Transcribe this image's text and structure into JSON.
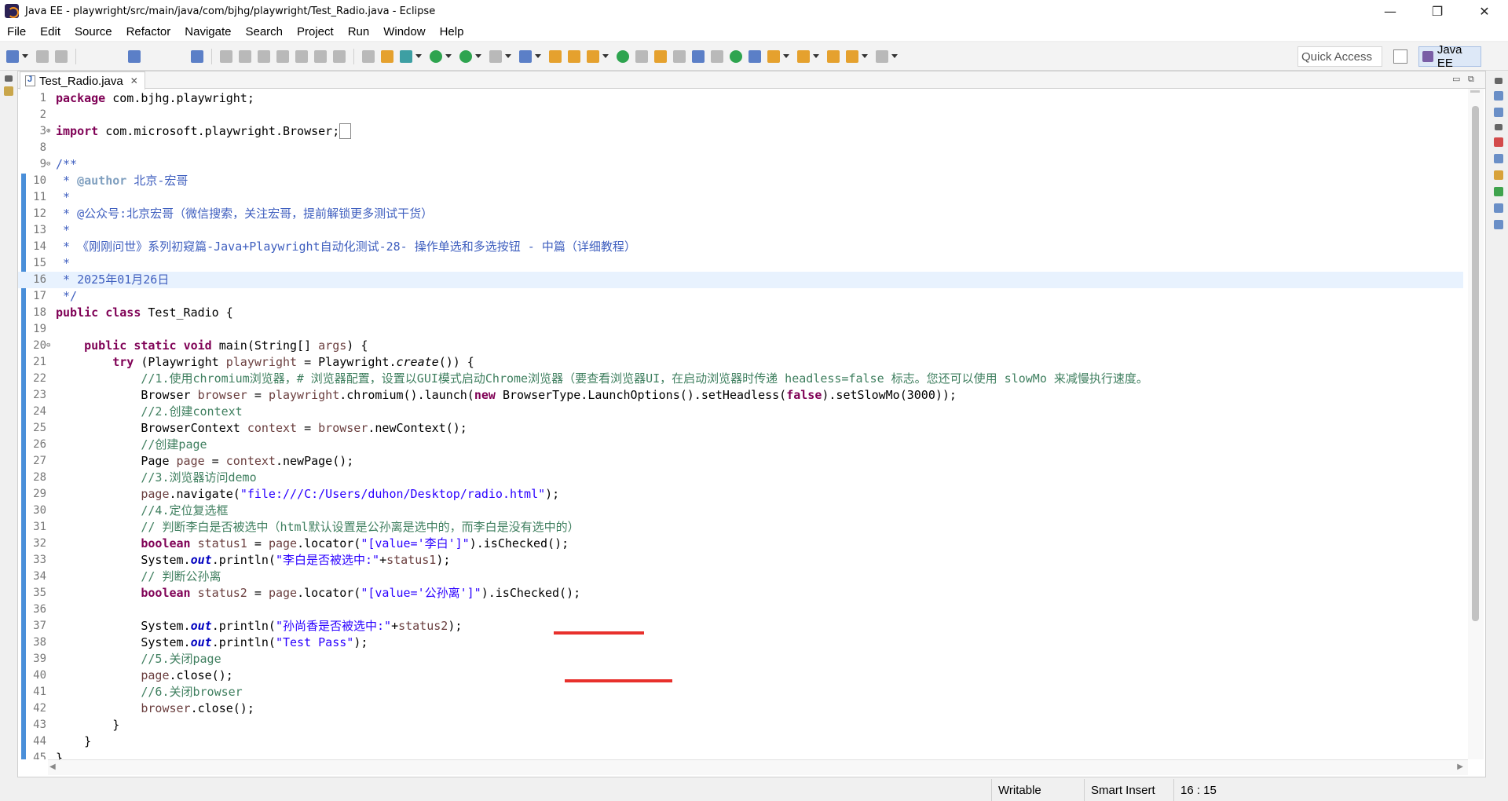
{
  "window": {
    "title": "Java EE - playwright/src/main/java/com/bjhg/playwright/Test_Radio.java - Eclipse",
    "minimize": "—",
    "maximize": "❐",
    "close": "✕"
  },
  "menu": [
    "File",
    "Edit",
    "Source",
    "Refactor",
    "Navigate",
    "Search",
    "Project",
    "Run",
    "Window",
    "Help"
  ],
  "toolbar": {
    "quick_access": "Quick Access",
    "perspective": "Java EE"
  },
  "editor": {
    "tab_label": "Test_Radio.java",
    "tab_close": "✕",
    "current_line": 16,
    "lines": [
      {
        "n": "1",
        "html": "<span class=\"kw\">package</span> com.bjhg.playwright;"
      },
      {
        "n": "2",
        "html": ""
      },
      {
        "n": "3",
        "fold": "⊕",
        "html": "<span class=\"kw\">import</span> com.microsoft.playwright.Browser;<span style=\"border:1px solid #888;padding:0 2px;\"> </span>"
      },
      {
        "n": "8",
        "html": ""
      },
      {
        "n": "9",
        "fold": "⊖",
        "html": "<span class=\"jd\">/**</span>"
      },
      {
        "n": "10",
        "html": "<span class=\"jd\"> * </span><span class=\"tag\">@author</span><span class=\"jd\"> 北京-宏哥</span>"
      },
      {
        "n": "11",
        "html": "<span class=\"jd\"> *</span>"
      },
      {
        "n": "12",
        "html": "<span class=\"jd\"> * @公众号:北京宏哥（微信搜索，关注宏哥，提前解锁更多测试干货）</span>"
      },
      {
        "n": "13",
        "html": "<span class=\"jd\"> *</span>"
      },
      {
        "n": "14",
        "html": "<span class=\"jd\"> * 《刚刚问世》系列初窥篇-Java+Playwright自动化测试-28- 操作单选和多选按钮 - 中篇（详细教程）</span>"
      },
      {
        "n": "15",
        "html": "<span class=\"jd\"> *</span>"
      },
      {
        "n": "16",
        "html": "<span class=\"jd\"> * 2025年01月26日</span>"
      },
      {
        "n": "17",
        "html": "<span class=\"jd\"> */</span>"
      },
      {
        "n": "18",
        "html": "<span class=\"kw\">public</span> <span class=\"kw\">class</span> Test_Radio {"
      },
      {
        "n": "19",
        "html": ""
      },
      {
        "n": "20",
        "fold": "⊖",
        "html": "    <span class=\"kw\">public</span> <span class=\"kw\">static</span> <span class=\"kw\">void</span> main(String[] <span class=\"lv\">args</span>) {"
      },
      {
        "n": "21",
        "html": "        <span class=\"kw\">try</span> (Playwright <span class=\"lv\">playwright</span> = Playwright.<span class=\"it\">create</span>()) {"
      },
      {
        "n": "22",
        "html": "            <span class=\"cm\">//1.使用chromium浏览器，# 浏览器配置，设置以GUI模式启动Chrome浏览器（要查看浏览器UI，在启动浏览器时传递 headless=false 标志。您还可以使用 slowMo 来减慢执行速度。</span>"
      },
      {
        "n": "23",
        "html": "            Browser <span class=\"lv\">browser</span> = <span class=\"lv\">playwright</span>.chromium().launch(<span class=\"kw\">new</span> BrowserType.LaunchOptions().setHeadless(<span class=\"kw\">false</span>).setSlowMo(3000));"
      },
      {
        "n": "24",
        "html": "            <span class=\"cm\">//2.创建context</span>"
      },
      {
        "n": "25",
        "html": "            BrowserContext <span class=\"lv\">context</span> = <span class=\"lv\">browser</span>.newContext();"
      },
      {
        "n": "26",
        "html": "            <span class=\"cm\">//创建page</span>"
      },
      {
        "n": "27",
        "html": "            Page <span class=\"lv\">page</span> = <span class=\"lv\">context</span>.newPage();"
      },
      {
        "n": "28",
        "html": "            <span class=\"cm\">//3.浏览器访问demo</span>"
      },
      {
        "n": "29",
        "html": "            <span class=\"lv\">page</span>.navigate(<span class=\"str\">\"file:///C:/Users/duhon/Desktop/radio.html\"</span>);"
      },
      {
        "n": "30",
        "html": "            <span class=\"cm\">//4.定位复选框</span>"
      },
      {
        "n": "31",
        "html": "            <span class=\"cm\">// 判断李白是否被选中（html默认设置是公孙离是选中的，而李白是没有选中的）</span>"
      },
      {
        "n": "32",
        "html": "            <span class=\"kw\">boolean</span> <span class=\"lv\">status1</span> = <span class=\"lv\">page</span>.locator(<span class=\"str\">\"[value='李白']\"</span>).isChecked();"
      },
      {
        "n": "33",
        "html": "            System.<span class=\"fld\">out</span>.println(<span class=\"str\">\"李白是否被选中:\"</span>+<span class=\"lv\">status1</span>);"
      },
      {
        "n": "34",
        "html": "            <span class=\"cm\">// 判断公孙离</span>"
      },
      {
        "n": "35",
        "html": "            <span class=\"kw\">boolean</span> <span class=\"lv\">status2</span> = <span class=\"lv\">page</span>.locator(<span class=\"str\">\"[value='公孙离']\"</span>).isChecked();"
      },
      {
        "n": "36",
        "html": ""
      },
      {
        "n": "37",
        "html": "            System.<span class=\"fld\">out</span>.println(<span class=\"str\">\"孙尚香是否被选中:\"</span>+<span class=\"lv\">status2</span>);"
      },
      {
        "n": "38",
        "html": "            System.<span class=\"fld\">out</span>.println(<span class=\"str\">\"Test Pass\"</span>);"
      },
      {
        "n": "39",
        "html": "            <span class=\"cm\">//5.关闭page</span>"
      },
      {
        "n": "40",
        "html": "            <span class=\"lv\">page</span>.close();"
      },
      {
        "n": "41",
        "html": "            <span class=\"cm\">//6.关闭browser</span>"
      },
      {
        "n": "42",
        "html": "            <span class=\"lv\">browser</span>.close();"
      },
      {
        "n": "43",
        "html": "        }"
      },
      {
        "n": "44",
        "html": "    }"
      },
      {
        "n": "45",
        "html": "}"
      }
    ]
  },
  "status": {
    "writable": "Writable",
    "insert_mode": "Smart Insert",
    "position": "16 : 15"
  }
}
